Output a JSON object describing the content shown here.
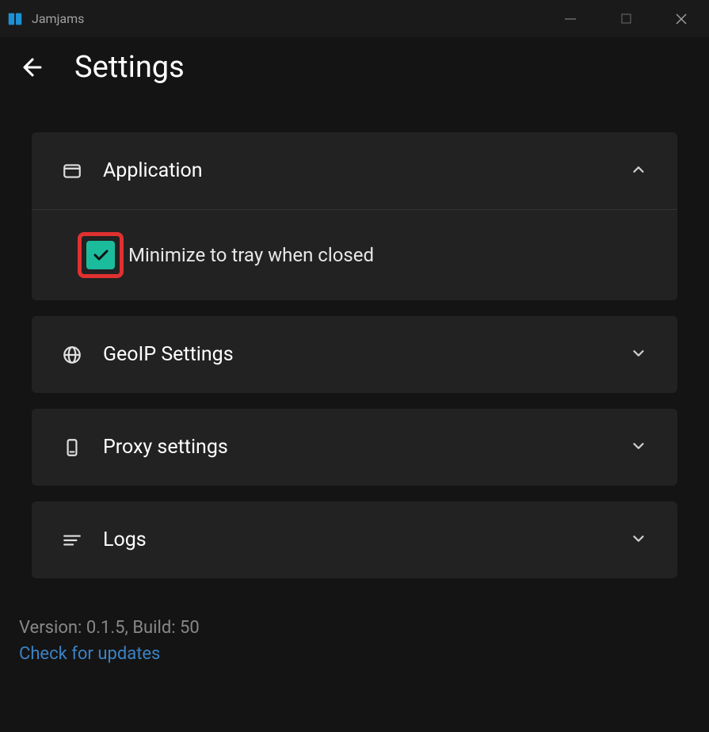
{
  "app": {
    "name": "Jamjams"
  },
  "page": {
    "title": "Settings"
  },
  "panels": {
    "application": {
      "title": "Application",
      "minimize_label": "Minimize to tray when closed",
      "minimize_checked": true
    },
    "geoip": {
      "title": "GeoIP Settings"
    },
    "proxy": {
      "title": "Proxy settings"
    },
    "logs": {
      "title": "Logs"
    }
  },
  "footer": {
    "version_text": "Version: 0.1.5, Build: 50",
    "update_link": "Check for updates"
  }
}
